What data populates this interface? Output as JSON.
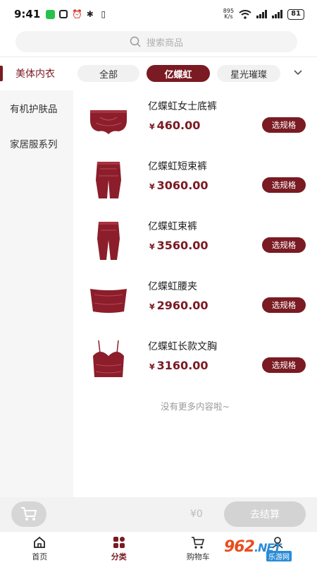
{
  "status_bar": {
    "time": "9:41",
    "net_speed_value": "895",
    "net_speed_unit": "K/s",
    "battery": "81"
  },
  "search": {
    "placeholder": "搜索商品"
  },
  "left_categories": [
    {
      "label": "美体内衣",
      "active": true
    },
    {
      "label": "有机护肤品",
      "active": false
    },
    {
      "label": "家居服系列",
      "active": false
    }
  ],
  "sub_tabs": [
    {
      "label": "全部",
      "active": false
    },
    {
      "label": "亿蝶虹",
      "active": true
    },
    {
      "label": "星光璀璨",
      "active": false
    }
  ],
  "products": [
    {
      "name": "亿蝶虹女士底裤",
      "currency": "¥",
      "price": "460.00",
      "button": "选规格"
    },
    {
      "name": "亿蝶虹短束裤",
      "currency": "¥",
      "price": "3060.00",
      "button": "选规格"
    },
    {
      "name": "亿蝶虹束裤",
      "currency": "¥",
      "price": "3560.00",
      "button": "选规格"
    },
    {
      "name": "亿蝶虹腰夹",
      "currency": "¥",
      "price": "2960.00",
      "button": "选规格"
    },
    {
      "name": "亿蝶虹长款文胸",
      "currency": "¥",
      "price": "3160.00",
      "button": "选规格"
    }
  ],
  "no_more_text": "没有更多内容啦~",
  "cart": {
    "total": "¥0",
    "checkout_label": "去结算"
  },
  "tabbar": [
    {
      "label": "首页",
      "icon": "home-icon",
      "active": false
    },
    {
      "label": "分类",
      "icon": "category-icon",
      "active": true
    },
    {
      "label": "购物车",
      "icon": "cart-icon",
      "active": false
    },
    {
      "label": "我的",
      "icon": "profile-icon",
      "active": false
    }
  ],
  "watermark": {
    "logo_main": "962",
    "logo_net": ".NET",
    "logo_sub": "乐游网"
  },
  "colors": {
    "brand": "#7a1a22",
    "product": "#8b1e2a"
  }
}
